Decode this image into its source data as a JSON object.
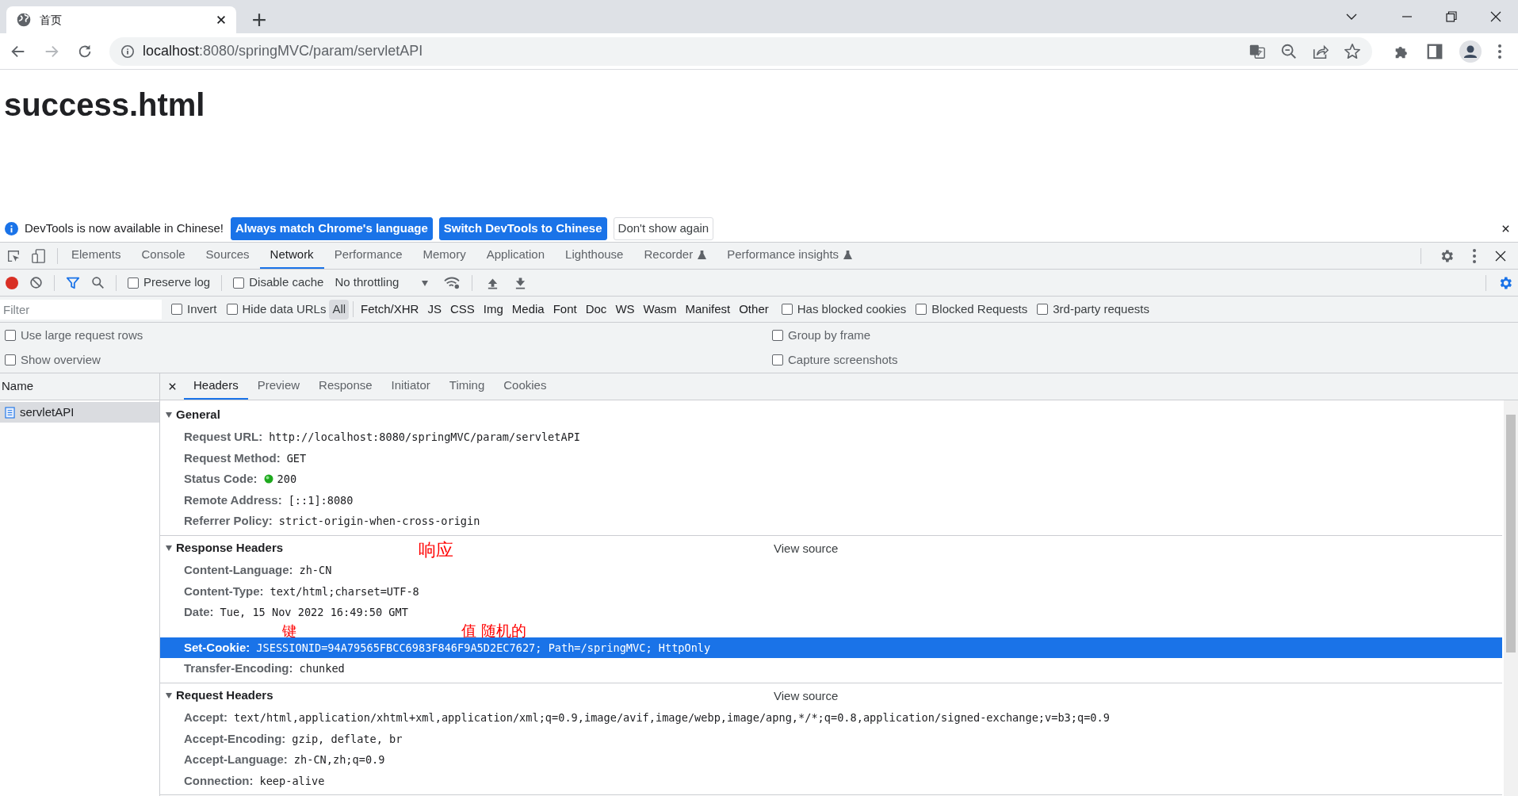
{
  "browser": {
    "tab": {
      "title": "首页"
    },
    "url": {
      "host": "localhost",
      "path": ":8080/springMVC/param/servletAPI"
    }
  },
  "page": {
    "heading": "success.html"
  },
  "infobar": {
    "message": "DevTools is now available in Chinese!",
    "buttons": [
      {
        "label": "Always match Chrome's language",
        "kind": "primary"
      },
      {
        "label": "Switch DevTools to Chinese",
        "kind": "primary"
      },
      {
        "label": "Don't show again",
        "kind": "secondary"
      }
    ]
  },
  "devtools_tabs": [
    {
      "label": "Elements",
      "selected": false,
      "experimental": false
    },
    {
      "label": "Console",
      "selected": false,
      "experimental": false
    },
    {
      "label": "Sources",
      "selected": false,
      "experimental": false
    },
    {
      "label": "Network",
      "selected": true,
      "experimental": false
    },
    {
      "label": "Performance",
      "selected": false,
      "experimental": false
    },
    {
      "label": "Memory",
      "selected": false,
      "experimental": false
    },
    {
      "label": "Application",
      "selected": false,
      "experimental": false
    },
    {
      "label": "Lighthouse",
      "selected": false,
      "experimental": false
    },
    {
      "label": "Recorder",
      "selected": false,
      "experimental": true
    },
    {
      "label": "Performance insights",
      "selected": false,
      "experimental": true
    }
  ],
  "network_toolbar": {
    "recording": true,
    "preserve_log": {
      "label": "Preserve log",
      "checked": false
    },
    "disable_cache": {
      "label": "Disable cache",
      "checked": false
    },
    "throttling": "No throttling"
  },
  "filter_bar": {
    "placeholder": "Filter",
    "invert": {
      "label": "Invert",
      "checked": false
    },
    "hide_data_urls": {
      "label": "Hide data URLs",
      "checked": false
    },
    "types": [
      {
        "label": "All",
        "selected": true
      },
      {
        "label": "Fetch/XHR",
        "selected": false
      },
      {
        "label": "JS",
        "selected": false
      },
      {
        "label": "CSS",
        "selected": false
      },
      {
        "label": "Img",
        "selected": false
      },
      {
        "label": "Media",
        "selected": false
      },
      {
        "label": "Font",
        "selected": false
      },
      {
        "label": "Doc",
        "selected": false
      },
      {
        "label": "WS",
        "selected": false
      },
      {
        "label": "Wasm",
        "selected": false
      },
      {
        "label": "Manifest",
        "selected": false
      },
      {
        "label": "Other",
        "selected": false
      }
    ],
    "extra": [
      {
        "label": "Has blocked cookies",
        "checked": false
      },
      {
        "label": "Blocked Requests",
        "checked": false
      },
      {
        "label": "3rd-party requests",
        "checked": false
      }
    ]
  },
  "options": [
    {
      "label": "Use large request rows",
      "checked": false
    },
    {
      "label": "Group by frame",
      "checked": false
    },
    {
      "label": "Show overview",
      "checked": false
    },
    {
      "label": "Capture screenshots",
      "checked": false
    }
  ],
  "requests": {
    "column": "Name",
    "rows": [
      {
        "name": "servletAPI",
        "selected": true
      }
    ]
  },
  "detail_tabs": [
    {
      "label": "Headers",
      "selected": true
    },
    {
      "label": "Preview",
      "selected": false
    },
    {
      "label": "Response",
      "selected": false
    },
    {
      "label": "Initiator",
      "selected": false
    },
    {
      "label": "Timing",
      "selected": false
    },
    {
      "label": "Cookies",
      "selected": false
    }
  ],
  "sections": [
    {
      "title": "General",
      "expanded": true,
      "rows": [
        {
          "key": "Request URL:",
          "value": "http://localhost:8080/springMVC/param/servletAPI",
          "kind": "plain",
          "selected": false
        },
        {
          "key": "Request Method:",
          "value": "GET",
          "kind": "plain",
          "selected": false
        },
        {
          "key": "Status Code:",
          "value": "200",
          "kind": "status",
          "selected": false
        },
        {
          "key": "Remote Address:",
          "value": "[::1]:8080",
          "kind": "plain",
          "selected": false
        },
        {
          "key": "Referrer Policy:",
          "value": "strict-origin-when-cross-origin",
          "kind": "plain",
          "selected": false
        }
      ]
    },
    {
      "title": "Response Headers",
      "expanded": true,
      "view_source": "View source",
      "annotation": "响应",
      "rows": [
        {
          "key": "Content-Language:",
          "value": "zh-CN",
          "kind": "plain",
          "selected": false
        },
        {
          "key": "Content-Type:",
          "value": "text/html;charset=UTF-8",
          "kind": "plain",
          "selected": false
        },
        {
          "key": "Date:",
          "value": "Tue, 15 Nov 2022 16:49:50 GMT",
          "kind": "plain",
          "selected": false
        },
        {
          "key": "Set-Cookie:",
          "value": "JSESSIONID=94A79565FBCC6983F846F9A5D2EC7627; Path=/springMVC; HttpOnly",
          "kind": "plain",
          "selected": true,
          "key_note": "键",
          "value_note": "值 随机的"
        },
        {
          "key": "Transfer-Encoding:",
          "value": "chunked",
          "kind": "plain",
          "selected": false
        }
      ]
    },
    {
      "title": "Request Headers",
      "expanded": true,
      "view_source": "View source",
      "rows": [
        {
          "key": "Accept:",
          "value": "text/html,application/xhtml+xml,application/xml;q=0.9,image/avif,image/webp,image/apng,*/*;q=0.8,application/signed-exchange;v=b3;q=0.9",
          "kind": "plain",
          "selected": false
        },
        {
          "key": "Accept-Encoding:",
          "value": "gzip, deflate, br",
          "kind": "plain",
          "selected": false
        },
        {
          "key": "Accept-Language:",
          "value": "zh-CN,zh;q=0.9",
          "kind": "plain",
          "selected": false
        },
        {
          "key": "Connection:",
          "value": "keep-alive",
          "kind": "plain",
          "selected": false
        }
      ]
    }
  ]
}
